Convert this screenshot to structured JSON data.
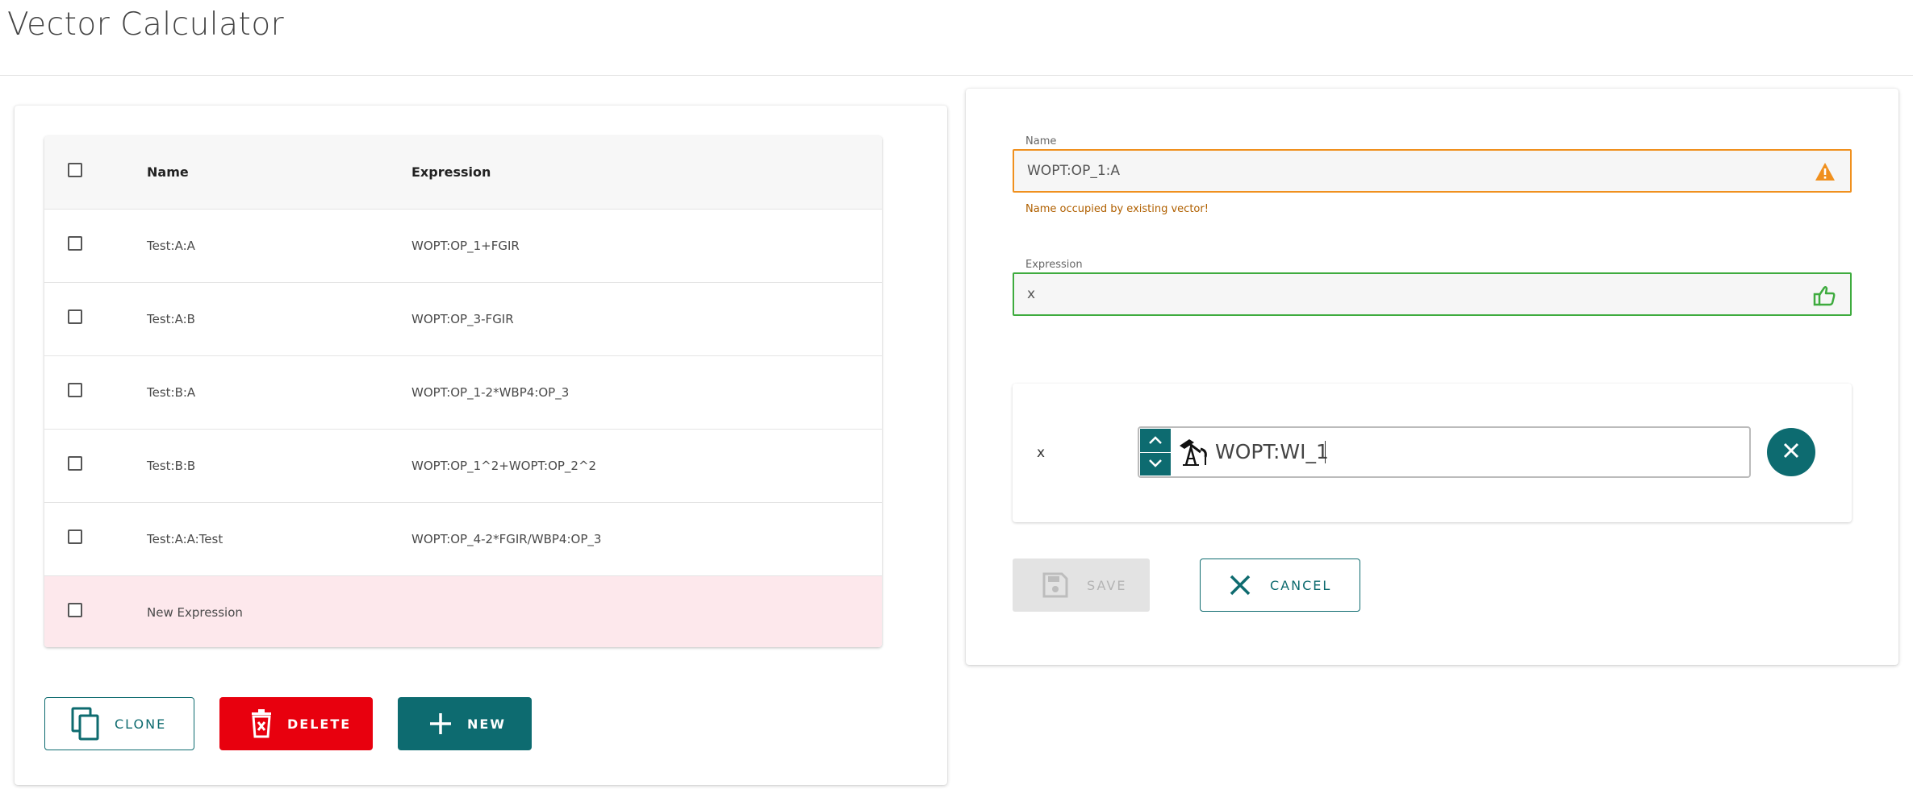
{
  "app": {
    "title": "Vector Calculator"
  },
  "table": {
    "headers": {
      "name": "Name",
      "expression": "Expression"
    },
    "rows": [
      {
        "name": "Test:A:A",
        "expression": "WOPT:OP_1+FGIR"
      },
      {
        "name": "Test:A:B",
        "expression": "WOPT:OP_3-FGIR"
      },
      {
        "name": "Test:B:A",
        "expression": "WOPT:OP_1-2*WBP4:OP_3"
      },
      {
        "name": "Test:B:B",
        "expression": "WOPT:OP_1^2+WOPT:OP_2^2"
      },
      {
        "name": "Test:A:A:Test",
        "expression": "WOPT:OP_4-2*FGIR/WBP4:OP_3"
      },
      {
        "name": "New Expression",
        "expression": ""
      }
    ]
  },
  "actions": {
    "clone": "CLONE",
    "delete": "DELETE",
    "new": "NEW"
  },
  "editor": {
    "name_label": "Name",
    "name_value": "WOPT:OP_1:A",
    "name_error": "Name occupied by existing vector!",
    "expression_label": "Expression",
    "expression_value": "x",
    "variable": {
      "name": "x",
      "vector": "WOPT:WI_1"
    },
    "save": "SAVE",
    "cancel": "CANCEL"
  },
  "colors": {
    "teal": "#0d6b70",
    "delete_red": "#e8000e",
    "warning_orange": "#f0901e",
    "valid_green": "#3eab3e",
    "new_row_pink": "#fde8ec"
  },
  "icons": {
    "clone": "copy-icon",
    "delete": "trash-icon",
    "new": "plus-icon",
    "name_status": "warning-icon",
    "expression_status": "thumbs-up-icon",
    "vector_type": "oil-well-icon",
    "remove_variable": "close-icon",
    "save": "floppy-disk-icon",
    "cancel": "close-icon"
  }
}
